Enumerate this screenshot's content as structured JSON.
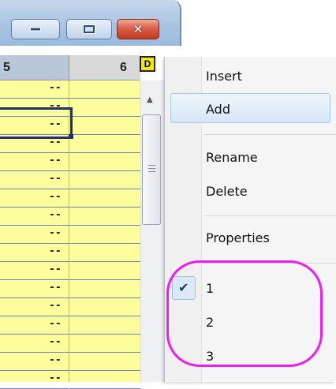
{
  "window": {
    "controls": {
      "minimize_icon": "minimize-icon",
      "maximize_icon": "maximize-icon",
      "close_icon": "close-icon"
    }
  },
  "grid": {
    "columns": [
      {
        "label": "5"
      },
      {
        "label": "6"
      }
    ],
    "d_button_label": "D",
    "row_cell_text": "--",
    "colors": {
      "cell_bg": "#fdfd9c",
      "header_bg": "#b9c7d8",
      "selected_border": "#1f2f6e"
    }
  },
  "context_menu": {
    "items": [
      {
        "label": "Insert"
      },
      {
        "label": "Add",
        "highlighted": true
      },
      {
        "label": "Rename"
      },
      {
        "label": "Delete"
      },
      {
        "label": "Properties"
      },
      {
        "label": "1",
        "checked": true
      },
      {
        "label": "2"
      },
      {
        "label": "3"
      }
    ],
    "check_icon": "checkmark-icon"
  },
  "annotation": {
    "color": "#ee1cee"
  }
}
